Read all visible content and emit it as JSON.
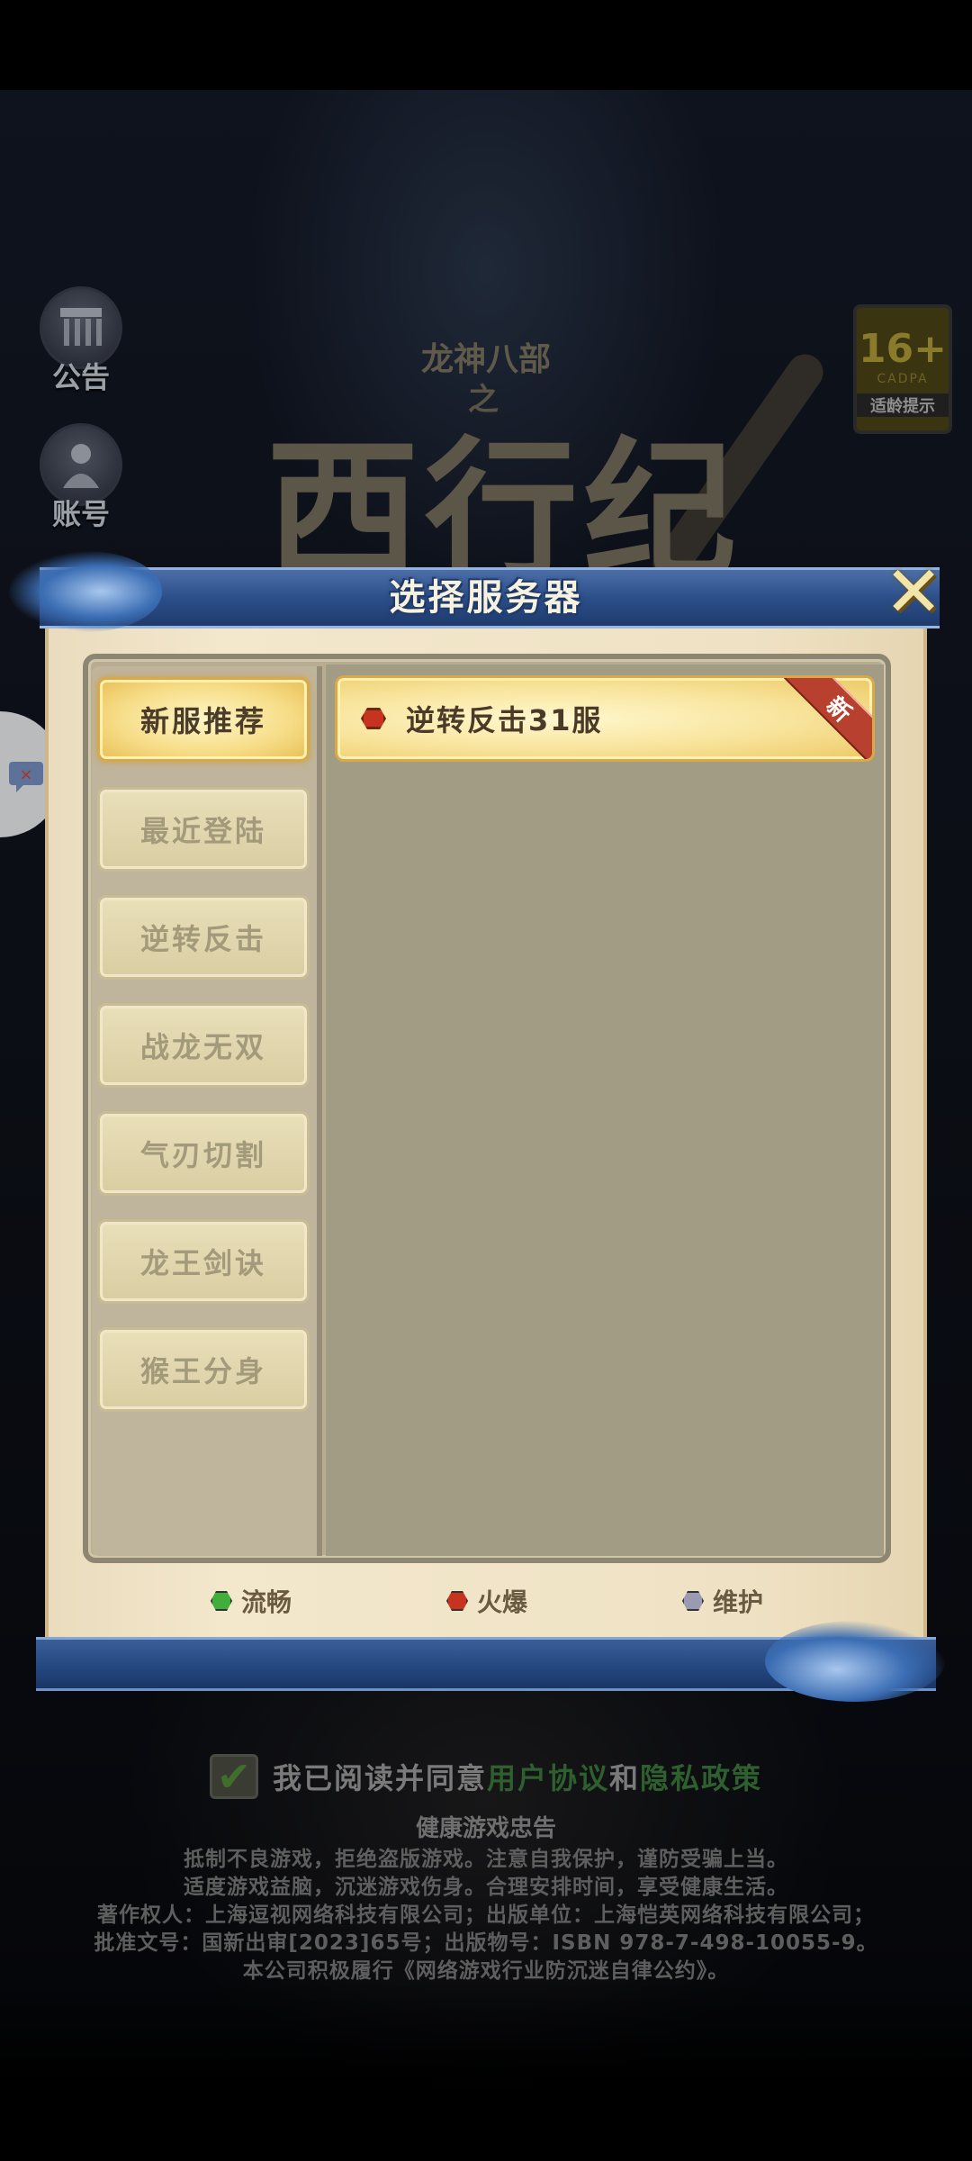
{
  "background": {
    "side_buttons": [
      {
        "label": "公告",
        "icon": "notice-board-icon"
      },
      {
        "label": "账号",
        "icon": "account-person-icon"
      }
    ],
    "age_badge": {
      "rating": "16+",
      "org": "CADPA",
      "tip": "适龄提示"
    },
    "logo": {
      "subtitle": "龙神八部",
      "connector": "之",
      "main": "西行纪"
    },
    "chat_icon": "chat-bubble-icon"
  },
  "dialog": {
    "title": "选择服务器",
    "close_icon": "close-x-icon",
    "categories": [
      {
        "label": "新服推荐",
        "active": true
      },
      {
        "label": "最近登陆",
        "active": false
      },
      {
        "label": "逆转反击",
        "active": false
      },
      {
        "label": "战龙无双",
        "active": false
      },
      {
        "label": "气刃切割",
        "active": false
      },
      {
        "label": "龙王剑诀",
        "active": false
      },
      {
        "label": "猴王分身",
        "active": false
      }
    ],
    "servers": [
      {
        "name": "逆转反击31服",
        "status": "火爆",
        "badge": "新"
      }
    ],
    "legend": [
      {
        "label": "流畅",
        "color": "#3fae3a"
      },
      {
        "label": "火爆",
        "color": "#c8331f"
      },
      {
        "label": "维护",
        "color": "#9a9bb2"
      }
    ]
  },
  "agreement": {
    "checked": true,
    "prefix": "我已阅读并同意",
    "user_agreement": "用户协议",
    "and": "和",
    "privacy_policy": "隐私政策"
  },
  "health_notice": {
    "title": "健康游戏忠告",
    "lines": [
      "抵制不良游戏，拒绝盗版游戏。注意自我保护，谨防受骗上当。",
      "适度游戏益脑，沉迷游戏伤身。合理安排时间，享受健康生活。",
      "著作权人：上海逗视网络科技有限公司；出版单位：上海恺英网络科技有限公司；",
      "批准文号：国新出审[2023]65号；出版物号：ISBN 978-7-498-10055-9。",
      "本公司积极履行《网络游戏行业防沉迷自律公约》。"
    ]
  }
}
